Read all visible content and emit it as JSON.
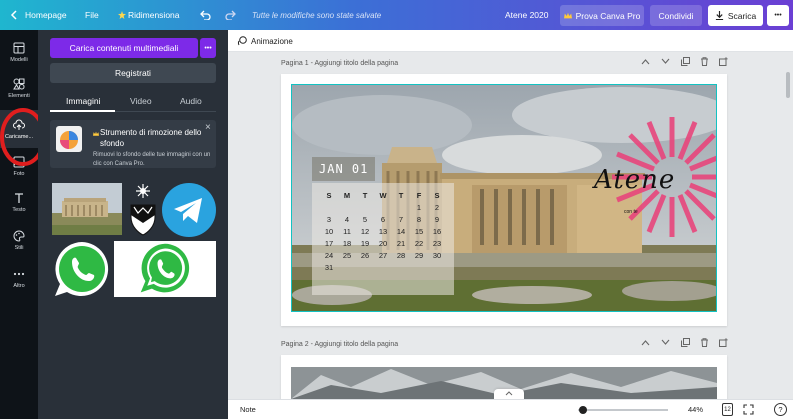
{
  "topbar": {
    "home_label": "Homepage",
    "file_label": "File",
    "resize_label": "Ridimensiona",
    "save_status": "Tutte le modifiche sono state salvate",
    "doc_title": "Atene 2020",
    "pro_label": "Prova Canva Pro",
    "share_label": "Condividi",
    "download_label": "Scarica",
    "more_label": "•••"
  },
  "rail": {
    "items": [
      {
        "label": "Modelli",
        "icon": "layout-icon"
      },
      {
        "label": "Elementi",
        "icon": "shapes-icon"
      },
      {
        "label": "Caricame...",
        "icon": "upload-cloud-icon"
      },
      {
        "label": "Foto",
        "icon": "photo-icon"
      },
      {
        "label": "Testo",
        "icon": "text-icon"
      },
      {
        "label": "Stili",
        "icon": "palette-icon"
      },
      {
        "label": "Altro",
        "icon": "more-dots-icon"
      }
    ]
  },
  "panel": {
    "upload_label": "Carica contenuti multimediali",
    "more_label": "•••",
    "record_label": "Registrati",
    "tabs": [
      "Immagini",
      "Video",
      "Audio"
    ],
    "promo_title": "Strumento di rimozione dello sfondo",
    "promo_text": "Rimuovi lo sfondo delle tue immagini con un clic con Canva Pro.",
    "close_label": "×"
  },
  "canvas": {
    "toolbar_label": "Animazione",
    "page1_label": "Pagina 1 - Aggiungi titolo della pagina",
    "page2_label": "Pagina 2 - Aggiungi titolo della pagina"
  },
  "calendar": {
    "month": "JAN 01",
    "weekdays": [
      "S",
      "M",
      "T",
      "W",
      "T",
      "F",
      "S"
    ],
    "rows": [
      [
        "",
        "",
        "",
        "",
        "",
        "1",
        "2"
      ],
      [
        "3",
        "4",
        "5",
        "6",
        "7",
        "8",
        "9"
      ],
      [
        "10",
        "11",
        "12",
        "13",
        "14",
        "15",
        "16"
      ],
      [
        "17",
        "18",
        "19",
        "20",
        "21",
        "22",
        "23"
      ],
      [
        "24",
        "25",
        "26",
        "27",
        "28",
        "29",
        "30"
      ],
      [
        "31",
        "",
        "",
        "",
        "",
        "",
        ""
      ]
    ]
  },
  "design": {
    "title": "Atene",
    "subtitle": "con te"
  },
  "bottombar": {
    "notes_label": "Note",
    "zoom": "44%",
    "page_count": "12",
    "help_label": "?"
  },
  "colors": {
    "accent_purple": "#7d2ae8",
    "annotation_red": "#e01e1e",
    "selection_teal": "#13c2c2",
    "sunburst_pink": "#e8467c"
  }
}
